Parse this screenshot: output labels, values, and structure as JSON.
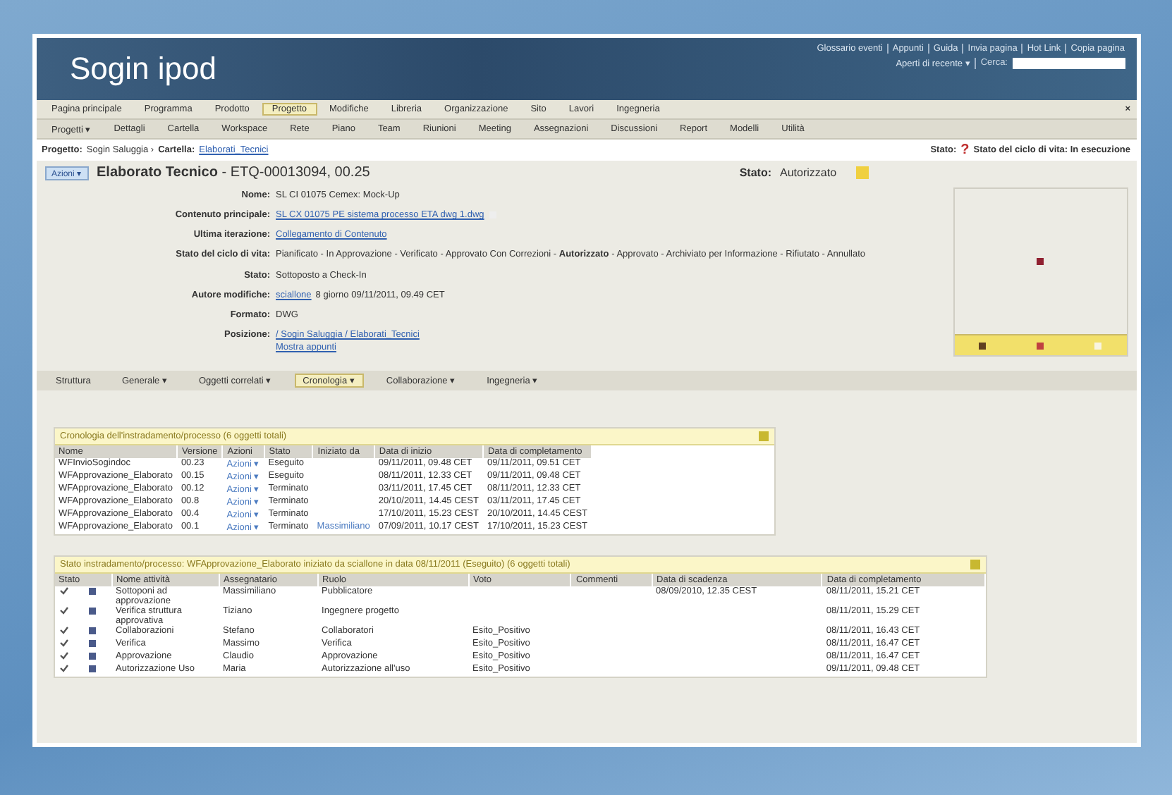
{
  "header": {
    "logo": "Sogin ipod",
    "links": [
      "Glossario eventi",
      "Appunti",
      "Guida",
      "Invia pagina",
      "Hot Link",
      "Copia pagina"
    ],
    "recent": "Aperti di recente ▾",
    "search_label": "Cerca:"
  },
  "nav_main": [
    {
      "label": "Pagina principale",
      "selected": false
    },
    {
      "label": "Programma",
      "selected": false
    },
    {
      "label": "Prodotto",
      "selected": false
    },
    {
      "label": "Progetto",
      "selected": true
    },
    {
      "label": "Modifiche",
      "selected": false
    },
    {
      "label": "Libreria",
      "selected": false
    },
    {
      "label": "Organizzazione",
      "selected": false
    },
    {
      "label": "Sito",
      "selected": false
    },
    {
      "label": "Lavori",
      "selected": false
    },
    {
      "label": "Ingegneria",
      "selected": false
    }
  ],
  "nav_close": "×",
  "nav_sub": [
    "Progetti ▾",
    "Dettagli",
    "Cartella",
    "Workspace",
    "Rete",
    "Piano",
    "Team",
    "Riunioni",
    "Meeting",
    "Assegnazioni",
    "Discussioni",
    "Report",
    "Modelli",
    "Utilità"
  ],
  "breadcrumb": {
    "project_label": "Progetto:",
    "project": "Sogin Saluggia ›",
    "folder_label": "Cartella:",
    "folder": "Elaborati_Tecnici",
    "state_label": "Stato:",
    "state_mark": "?",
    "state": "Stato del ciclo di vita: In esecuzione"
  },
  "object": {
    "actions": "Azioni ▾",
    "title": "Elaborato Tecnico",
    "code": "- ETQ-00013094, 00.25",
    "status_label": "Stato:",
    "status": "Autorizzato"
  },
  "fields": [
    {
      "label": "Nome:",
      "kind": "text",
      "value": "SL CI 01075 Cemex: Mock-Up"
    },
    {
      "label": "Contenuto principale:",
      "kind": "link",
      "value": "SL CX 01075 PE sistema processo ETA dwg 1.dwg"
    },
    {
      "label": "Ultima iterazione:",
      "kind": "link",
      "value": "Collegamento di Contenuto"
    },
    {
      "label": "Stato del ciclo di vita:",
      "kind": "lifecycle",
      "value": "Pianificato - In Approvazione - Verificato - Approvato Con Correzioni - **Autorizzato** - Approvato - Archiviato per Informazione - Rifiutato - Annullato"
    },
    {
      "label": "Stato:",
      "kind": "text",
      "value": "Sottoposto a Check-In"
    },
    {
      "label": "Autore modifiche:",
      "kind": "author",
      "link": "sciallone",
      "value": "8 giorno 09/11/2011, 09.49 CET"
    },
    {
      "label": "Formato:",
      "kind": "text",
      "value": "DWG"
    },
    {
      "label": "Posizione:",
      "kind": "path",
      "value": "/ Sogin Saluggia / Elaborati_Tecnici",
      "extra": "Mostra appunti"
    }
  ],
  "tabs": [
    {
      "label": "Struttura",
      "selected": false
    },
    {
      "label": "Generale ▾",
      "selected": false
    },
    {
      "label": "Oggetti correlati ▾",
      "selected": false
    },
    {
      "label": "Cronologia ▾",
      "selected": true
    },
    {
      "label": "Collaborazione ▾",
      "selected": false
    },
    {
      "label": "Ingegneria ▾",
      "selected": false
    }
  ],
  "history": {
    "title": "Cronologia dell'instradamento/processo (6 oggetti totali)",
    "columns": [
      "Nome",
      "Versione",
      "Azioni",
      "Stato",
      "Iniziato da",
      "Data di inizio",
      "Data di completamento"
    ],
    "rows": [
      [
        "WFInvioSogindoc",
        "00.23",
        "Azioni ▾",
        "Eseguito",
        "",
        "09/11/2011, 09.48 CET",
        "09/11/2011, 09.51 CET"
      ],
      [
        "WFApprovazione_Elaborato",
        "00.15",
        "Azioni ▾",
        "Eseguito",
        "",
        "08/11/2011, 12.33 CET",
        "09/11/2011, 09.48 CET"
      ],
      [
        "WFApprovazione_Elaborato",
        "00.12",
        "Azioni ▾",
        "Terminato",
        "",
        "03/11/2011, 17.45 CET",
        "08/11/2011, 12.33 CET"
      ],
      [
        "WFApprovazione_Elaborato",
        "00.8",
        "Azioni ▾",
        "Terminato",
        "",
        "20/10/2011, 14.45 CEST",
        "03/11/2011, 17.45 CET"
      ],
      [
        "WFApprovazione_Elaborato",
        "00.4",
        "Azioni ▾",
        "Terminato",
        "",
        "17/10/2011, 15.23 CEST",
        "20/10/2011, 14.45 CEST"
      ],
      [
        "WFApprovazione_Elaborato",
        "00.1",
        "Azioni ▾",
        "Terminato",
        "Massimiliano",
        "07/09/2011, 10.17 CEST",
        "17/10/2011, 15.23 CEST"
      ]
    ]
  },
  "activities": {
    "title": "Stato instradamento/processo: WFApprovazione_Elaborato iniziato da sciallone in data 08/11/2011 (Eseguito) (6 oggetti totali)",
    "columns": [
      "Stato",
      "Nome attività",
      "Assegnatario",
      "Ruolo",
      "Voto",
      "Commenti",
      "Data di scadenza",
      "Data di completamento"
    ],
    "rows": [
      {
        "done": true,
        "name": "Sottoponi ad approvazione",
        "assignee": "Massimiliano",
        "role": "Pubblicatore",
        "vote": "",
        "comment": "",
        "due": "08/09/2010, 12.35 CEST",
        "completed": "08/11/2011, 15.21 CET"
      },
      {
        "done": true,
        "name": "Verifica struttura approvativa",
        "assignee": "Tiziano",
        "role": "Ingegnere progetto",
        "vote": "",
        "comment": "",
        "due": "",
        "completed": "08/11/2011, 15.29 CET"
      },
      {
        "done": true,
        "name": "Collaborazioni",
        "assignee": "Stefano",
        "role": "Collaboratori",
        "vote": "Esito_Positivo",
        "comment": "",
        "due": "",
        "completed": "08/11/2011, 16.43 CET"
      },
      {
        "done": true,
        "name": "Verifica",
        "assignee": "Massimo",
        "role": "Verifica",
        "vote": "Esito_Positivo",
        "comment": "",
        "due": "",
        "completed": "08/11/2011, 16.47 CET"
      },
      {
        "done": true,
        "name": "Approvazione",
        "assignee": "Claudio",
        "role": "Approvazione",
        "vote": "Esito_Positivo",
        "comment": "",
        "due": "",
        "completed": "08/11/2011, 16.47 CET"
      },
      {
        "done": true,
        "name": "Autorizzazione Uso",
        "assignee": "Maria",
        "role": "Autorizzazione all'uso",
        "vote": "Esito_Positivo",
        "comment": "",
        "due": "",
        "completed": "09/11/2011, 09.48 CET"
      }
    ]
  }
}
